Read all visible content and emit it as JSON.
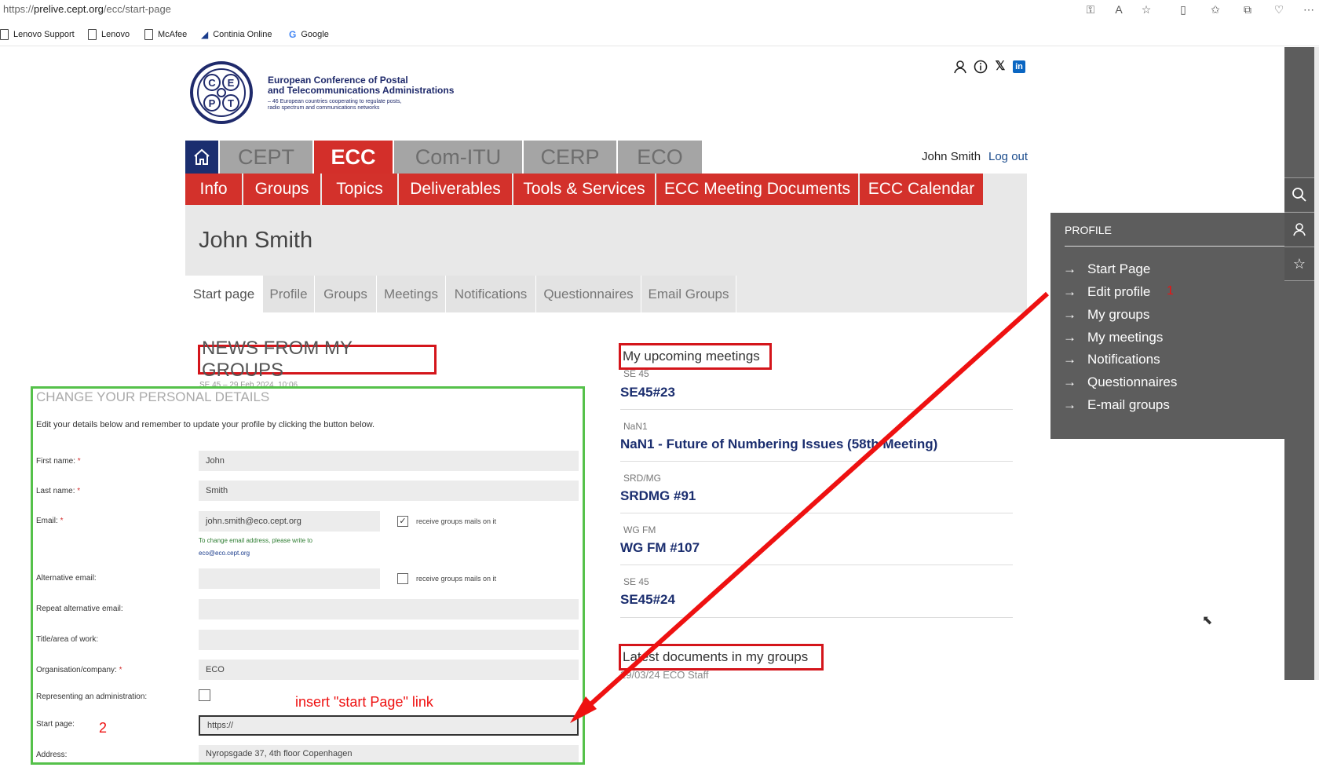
{
  "browser": {
    "url_scheme": "https://",
    "url_host": "prelive.cept.org",
    "url_path": "/ecc/start-page",
    "bookmarks": [
      "Lenovo Support",
      "Lenovo",
      "McAfee",
      "Continia Online",
      "Google"
    ]
  },
  "header": {
    "org_title_line1": "European Conference of Postal",
    "org_title_line2": "and Telecommunications Administrations",
    "org_sub_line1": "– 46 European countries cooperating to regulate posts,",
    "org_sub_line2": "radio spectrum and communications networks",
    "logo_letters": [
      "C",
      "E",
      "P",
      "T"
    ]
  },
  "main_nav": {
    "tabs": [
      "CEPT",
      "ECC",
      "Com-ITU",
      "CERP",
      "ECO"
    ],
    "active": "ECC",
    "user_name": "John Smith",
    "logout_label": "Log out"
  },
  "sub_nav": [
    "Info",
    "Groups",
    "Topics",
    "Deliverables",
    "Tools & Services",
    "ECC Meeting Documents",
    "ECC Calendar"
  ],
  "profile": {
    "title": "John Smith",
    "tabs": [
      "Start page",
      "Profile",
      "Groups",
      "Meetings",
      "Notifications",
      "Questionnaires",
      "Email Groups"
    ],
    "active_tab": "Start page"
  },
  "news": {
    "heading": "NEWS FROM MY GROUPS",
    "meta": "SE 45 – 29 Feb 2024, 10:06"
  },
  "change_details": {
    "title": "CHANGE YOUR PERSONAL DETAILS",
    "intro": "Edit your details below and remember to update your profile by clicking the button below.",
    "required_mark": "*",
    "fields": {
      "first_name": {
        "label": "First name:",
        "value": "John"
      },
      "last_name": {
        "label": "Last name:",
        "value": "Smith"
      },
      "email": {
        "label": "Email:",
        "value": "john.smith@eco.cept.org",
        "checkbox_label": "receive groups mails on it",
        "checked": true
      },
      "email_note": "To change email address, please write to",
      "email_note_link": "eco@eco.cept.org",
      "alt_email": {
        "label": "Alternative email:",
        "value": "",
        "checkbox_label": "receive groups mails on it",
        "checked": false
      },
      "repeat_alt_email": {
        "label": "Repeat alternative email:",
        "value": ""
      },
      "title_area": {
        "label": "Title/area of work:",
        "value": ""
      },
      "organisation": {
        "label": "Organisation/company:",
        "value": "ECO"
      },
      "representing": {
        "label": "Representing an administration:",
        "checked": false
      },
      "start_page": {
        "label": "Start page:",
        "value": "https://"
      },
      "address": {
        "label": "Address:",
        "value": "Nyropsgade 37, 4th floor Copenhagen"
      }
    }
  },
  "annotations": {
    "insert_note": "insert \"start Page\" link",
    "num1": "1",
    "num2": "2",
    "arrow_color": "#e11",
    "box_color": "#d4151b",
    "green_box_color": "#55c14a"
  },
  "meetings": {
    "heading": "My upcoming meetings",
    "items": [
      {
        "group": "SE 45",
        "title": "SE45#23"
      },
      {
        "group": "NaN1",
        "title": "NaN1 - Future of Numbering Issues (58th Meeting)"
      },
      {
        "group": "SRD/MG",
        "title": "SRDMG #91"
      },
      {
        "group": "WG FM",
        "title": "WG FM #107"
      },
      {
        "group": "SE 45",
        "title": "SE45#24"
      }
    ]
  },
  "documents": {
    "heading": "Latest documents in my groups",
    "meta": "29/03/24 ECO Staff"
  },
  "profile_panel": {
    "title": "PROFILE",
    "items": [
      "Start Page",
      "Edit profile",
      "My groups",
      "My meetings",
      "Notifications",
      "Questionnaires",
      "E-mail groups"
    ]
  },
  "colors": {
    "ecc_red": "#d32f2a",
    "navy": "#1b2e6f",
    "panel_gray": "#5d5d5d"
  }
}
